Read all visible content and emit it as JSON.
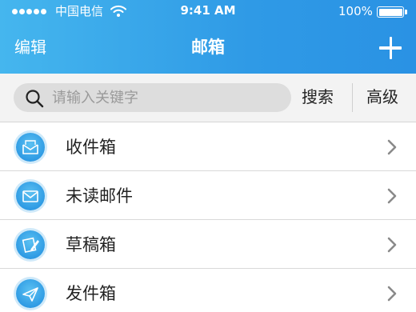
{
  "status_bar": {
    "carrier": "中国电信",
    "time": "9:41 AM",
    "battery": "100%"
  },
  "nav": {
    "edit_label": "编辑",
    "title": "邮箱",
    "add_icon": "plus-icon"
  },
  "search": {
    "placeholder": "请输入关键字",
    "search_label": "搜索",
    "advanced_label": "高级"
  },
  "mailboxes": [
    {
      "label": "收件箱",
      "icon": "inbox-icon"
    },
    {
      "label": "未读邮件",
      "icon": "envelope-icon"
    },
    {
      "label": "草稿箱",
      "icon": "draft-icon"
    },
    {
      "label": "发件箱",
      "icon": "send-icon"
    }
  ],
  "colors": {
    "header_start": "#45b6ee",
    "header_end": "#2a92e4",
    "icon_blue": "#2f9be4"
  }
}
